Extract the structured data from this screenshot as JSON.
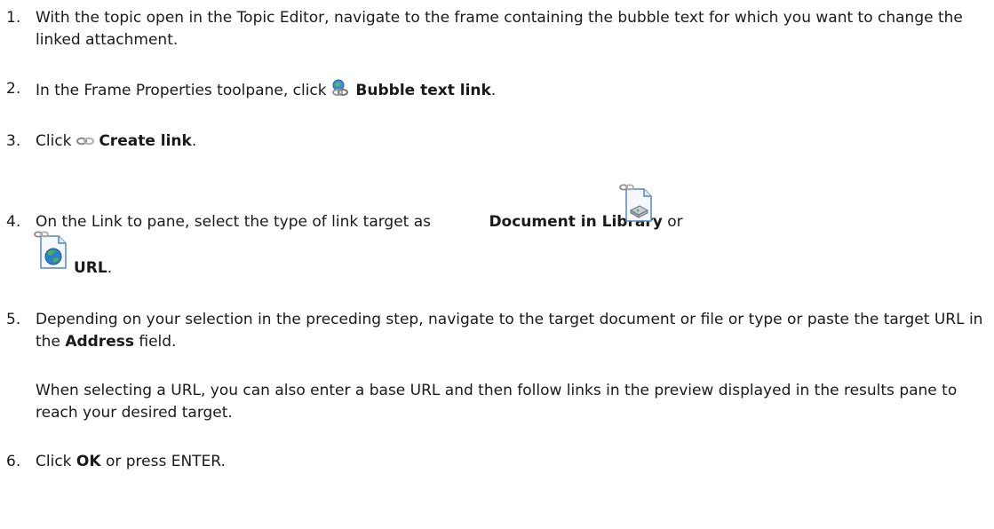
{
  "steps": [
    {
      "number": "1.",
      "text": "With the topic open in the Topic Editor, navigate to the frame containing the bubble text for which you want to change the linked attachment."
    },
    {
      "number": "2.",
      "prefix": "In the Frame Properties toolpane, click ",
      "bold": "Bubble text link",
      "suffix": ".",
      "icon": "bubble-text-link-icon"
    },
    {
      "number": "3.",
      "prefix": "Click ",
      "bold": "Create link",
      "suffix": ".",
      "icon": "create-link-icon"
    },
    {
      "number": "4.",
      "prefix": "On the Link to pane, select the type of link target as ",
      "bold1": "Document in Library",
      "middle": " or",
      "bold2": "URL",
      "suffix": ".",
      "icon1": "document-in-library-icon",
      "icon2": "url-globe-icon"
    },
    {
      "number": "5.",
      "prefix": "Depending on your selection in the preceding step, navigate to the target document or file or type or paste the target URL in the ",
      "bold": "Address",
      "suffix": " field.",
      "note": "When selecting a URL, you can also enter a base URL and then follow links in the preview displayed in the results pane to reach your desired target."
    },
    {
      "number": "6.",
      "prefix": "Click ",
      "bold": "OK",
      "suffix": " or press ENTER."
    }
  ],
  "colors": {
    "text": "#1a1a1a",
    "background": "#ffffff"
  }
}
